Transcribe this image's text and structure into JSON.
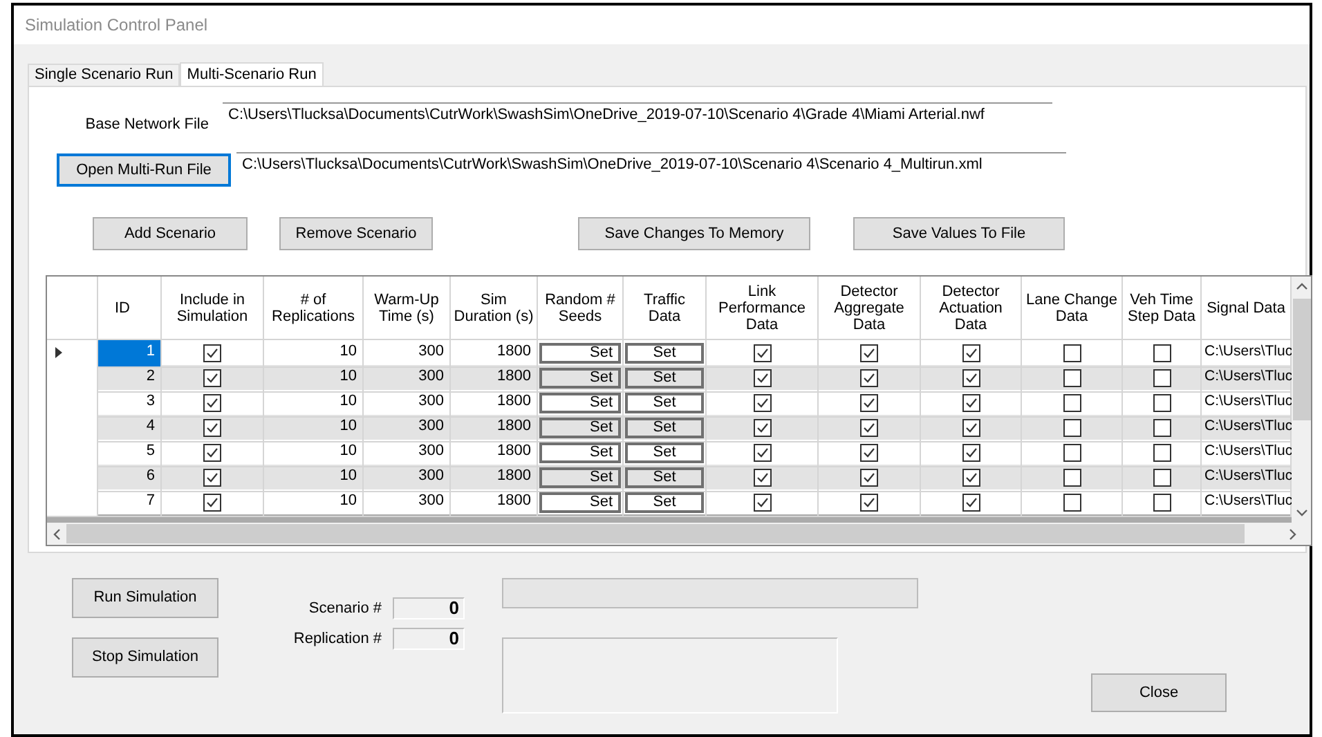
{
  "window": {
    "title": "Simulation Control Panel"
  },
  "tabs": [
    {
      "label": "Single Scenario Run",
      "selected": false
    },
    {
      "label": "Multi-Scenario Run",
      "selected": true
    }
  ],
  "base_network_file": {
    "label": "Base Network File",
    "value": "C:\\Users\\Tlucksa\\Documents\\CutrWork\\SwashSim\\OneDrive_2019-07-10\\Scenario 4\\Grade 4\\Miami Arterial.nwf"
  },
  "multi_run_file": {
    "button": "Open Multi-Run File",
    "value": "C:\\Users\\Tlucksa\\Documents\\CutrWork\\SwashSim\\OneDrive_2019-07-10\\Scenario 4\\Scenario 4_Multirun.xml"
  },
  "actions": [
    "Add Scenario",
    "Remove Scenario",
    "Save Changes To Memory",
    "Save Values To File"
  ],
  "table": {
    "columns": [
      {
        "label": "ID",
        "kind": "id"
      },
      {
        "label": "Include in Simulation",
        "kind": "check"
      },
      {
        "label": "# of Replications",
        "kind": "number"
      },
      {
        "label": "Warm-Up Time (s)",
        "kind": "number"
      },
      {
        "label": "Sim Duration (s)",
        "kind": "number"
      },
      {
        "label": "Random # Seeds",
        "kind": "button"
      },
      {
        "label": "Traffic Data",
        "kind": "button"
      },
      {
        "label": "Link Performance Data",
        "kind": "check"
      },
      {
        "label": "Detector Aggregate Data",
        "kind": "check"
      },
      {
        "label": "Detector Actuation Data",
        "kind": "check"
      },
      {
        "label": "Lane Change Data",
        "kind": "check"
      },
      {
        "label": "Veh Time Step Data",
        "kind": "check"
      },
      {
        "label": "Signal Data",
        "kind": "text"
      }
    ],
    "rows": [
      {
        "current": true,
        "selected": true,
        "cells": [
          "1",
          {
            "checked": true
          },
          "10",
          "300",
          "1800",
          "Set",
          "Set",
          {
            "checked": true
          },
          {
            "checked": true
          },
          {
            "checked": true
          },
          {
            "checked": false
          },
          {
            "checked": false
          },
          "C:\\Users\\Tluc"
        ]
      },
      {
        "current": false,
        "selected": false,
        "cells": [
          "2",
          {
            "checked": true
          },
          "10",
          "300",
          "1800",
          "Set",
          "Set",
          {
            "checked": true
          },
          {
            "checked": true
          },
          {
            "checked": true
          },
          {
            "checked": false
          },
          {
            "checked": false
          },
          "C:\\Users\\Tluc"
        ]
      },
      {
        "current": false,
        "selected": false,
        "cells": [
          "3",
          {
            "checked": true
          },
          "10",
          "300",
          "1800",
          "Set",
          "Set",
          {
            "checked": true
          },
          {
            "checked": true
          },
          {
            "checked": true
          },
          {
            "checked": false
          },
          {
            "checked": false
          },
          "C:\\Users\\Tluc"
        ]
      },
      {
        "current": false,
        "selected": false,
        "cells": [
          "4",
          {
            "checked": true
          },
          "10",
          "300",
          "1800",
          "Set",
          "Set",
          {
            "checked": true
          },
          {
            "checked": true
          },
          {
            "checked": true
          },
          {
            "checked": false
          },
          {
            "checked": false
          },
          "C:\\Users\\Tluc"
        ]
      },
      {
        "current": false,
        "selected": false,
        "cells": [
          "5",
          {
            "checked": true
          },
          "10",
          "300",
          "1800",
          "Set",
          "Set",
          {
            "checked": true
          },
          {
            "checked": true
          },
          {
            "checked": true
          },
          {
            "checked": false
          },
          {
            "checked": false
          },
          "C:\\Users\\Tluc"
        ]
      },
      {
        "current": false,
        "selected": false,
        "cells": [
          "6",
          {
            "checked": true
          },
          "10",
          "300",
          "1800",
          "Set",
          "Set",
          {
            "checked": true
          },
          {
            "checked": true
          },
          {
            "checked": true
          },
          {
            "checked": false
          },
          {
            "checked": false
          },
          "C:\\Users\\Tluc"
        ]
      },
      {
        "current": false,
        "selected": false,
        "cells": [
          "7",
          {
            "checked": true
          },
          "10",
          "300",
          "1800",
          "Set",
          "Set",
          {
            "checked": true
          },
          {
            "checked": true
          },
          {
            "checked": true
          },
          {
            "checked": false
          },
          {
            "checked": false
          },
          "C:\\Users\\Tluc"
        ]
      }
    ]
  },
  "run_button": "Run Simulation",
  "stop_button": "Stop Simulation",
  "counters": [
    {
      "label": "Scenario #",
      "value": "0"
    },
    {
      "label": "Replication #",
      "value": "0"
    }
  ],
  "progress": {
    "level": 0
  },
  "close_button": "Close"
}
